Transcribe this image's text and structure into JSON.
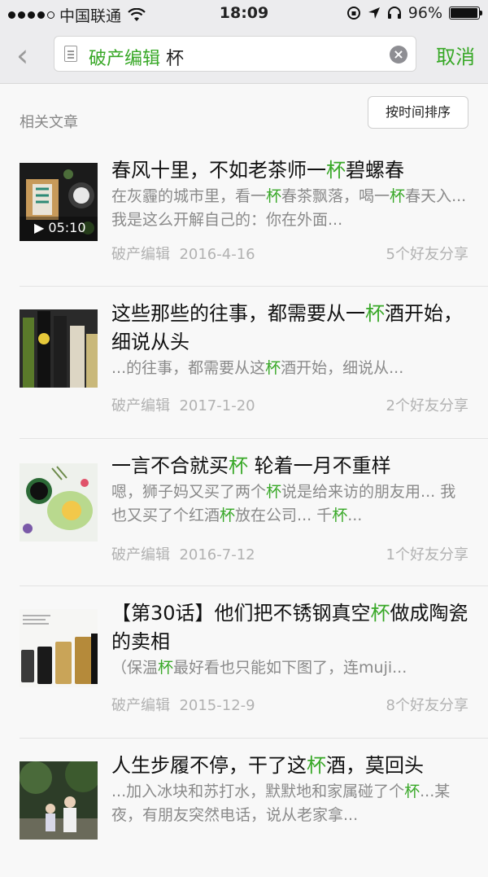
{
  "status_bar": {
    "carrier": "中国联通",
    "time": "18:09",
    "battery": "96%",
    "battery_fraction": 0.96,
    "signal_icon": "wifi-icon"
  },
  "search": {
    "prefix": "破产编辑",
    "query": "杯",
    "cancel_label": "取消"
  },
  "section": {
    "title": "相关文章",
    "sort_label": "按时间排序"
  },
  "articles": [
    {
      "title": [
        [
          "春风十里，不如老茶师一",
          false
        ],
        [
          "杯",
          true
        ],
        [
          "碧螺春",
          false
        ]
      ],
      "snippet": [
        [
          "在灰霾的城市里，看一",
          false
        ],
        [
          "杯",
          true
        ],
        [
          "春茶飘落，喝一",
          false
        ],
        [
          "杯",
          true
        ],
        [
          "春天入...我是这么开解自己的：你在外面...",
          false
        ]
      ],
      "author": "破产编辑",
      "date": "2016-4-16",
      "shares": "5个好友分享",
      "video_duration": "05:10"
    },
    {
      "title": [
        [
          "这些那些的往事，都需要从一",
          false
        ],
        [
          "杯",
          true
        ],
        [
          "酒开始，细说从头",
          false
        ]
      ],
      "snippet": [
        [
          "...的往事，都需要从这",
          false
        ],
        [
          "杯",
          true
        ],
        [
          "酒开始，细说从...",
          false
        ]
      ],
      "author": "破产编辑",
      "date": "2017-1-20",
      "shares": "2个好友分享"
    },
    {
      "title": [
        [
          "一言不合就买",
          false
        ],
        [
          "杯",
          true
        ],
        [
          " 轮着一月不重样",
          false
        ]
      ],
      "snippet": [
        [
          "嗯，狮子妈又买了两个",
          false
        ],
        [
          "杯",
          true
        ],
        [
          "说是给来访的朋友用... 我也又买了个红酒",
          false
        ],
        [
          "杯",
          true
        ],
        [
          "放在公司... 千",
          false
        ],
        [
          "杯",
          true
        ],
        [
          "...",
          false
        ]
      ],
      "author": "破产编辑",
      "date": "2016-7-12",
      "shares": "1个好友分享"
    },
    {
      "title": [
        [
          "【第30话】他们把不锈钢真空",
          false
        ],
        [
          "杯",
          true
        ],
        [
          "做成陶瓷的卖相",
          false
        ]
      ],
      "snippet": [
        [
          "（保温",
          false
        ],
        [
          "杯",
          true
        ],
        [
          "最好看也只能如下图了，连muji...",
          false
        ]
      ],
      "author": "破产编辑",
      "date": "2015-12-9",
      "shares": "8个好友分享"
    },
    {
      "title": [
        [
          "人生步履不停，干了这",
          false
        ],
        [
          "杯",
          true
        ],
        [
          "酒，莫回头",
          false
        ]
      ],
      "snippet": [
        [
          "...加入冰块和苏打水，默默地和家属碰了个",
          false
        ],
        [
          "杯",
          true
        ],
        [
          "...某夜，有朋友突然电话，说从老家拿...",
          false
        ]
      ],
      "author": "",
      "date": "",
      "shares": ""
    }
  ],
  "colors": {
    "accent": "#38a827",
    "bar_bg": "#ececee",
    "meta": "#b2b2b2"
  }
}
